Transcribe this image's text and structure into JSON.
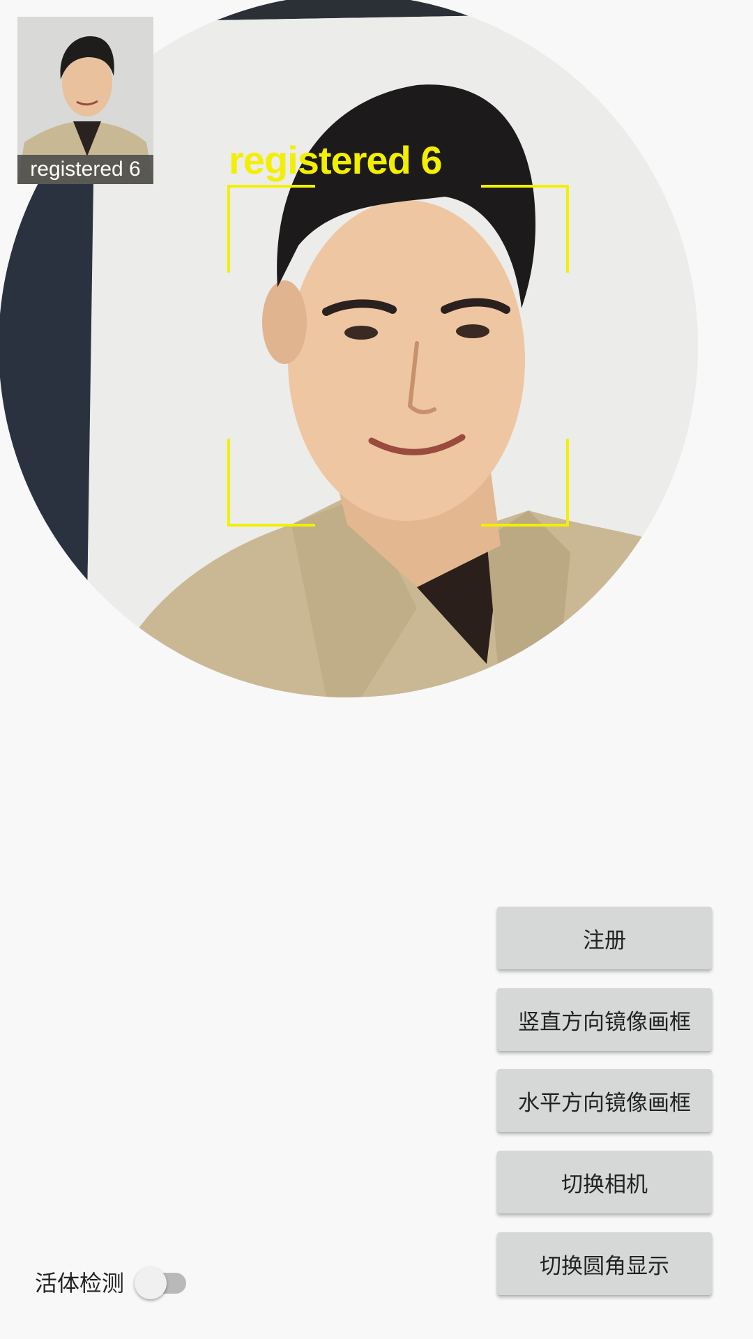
{
  "preview": {
    "face_label": "registered 6"
  },
  "thumbnail": {
    "label": "registered 6"
  },
  "buttons": {
    "register": "注册",
    "mirror_vertical": "竖直方向镜像画框",
    "mirror_horizontal": "水平方向镜像画框",
    "switch_camera": "切换相机",
    "toggle_round": "切换圆角显示"
  },
  "liveness": {
    "label": "活体检测",
    "enabled": false
  },
  "colors": {
    "detection_frame": "#f2f000",
    "button_bg": "#d6d8d7",
    "background": "#f7f8f7"
  }
}
